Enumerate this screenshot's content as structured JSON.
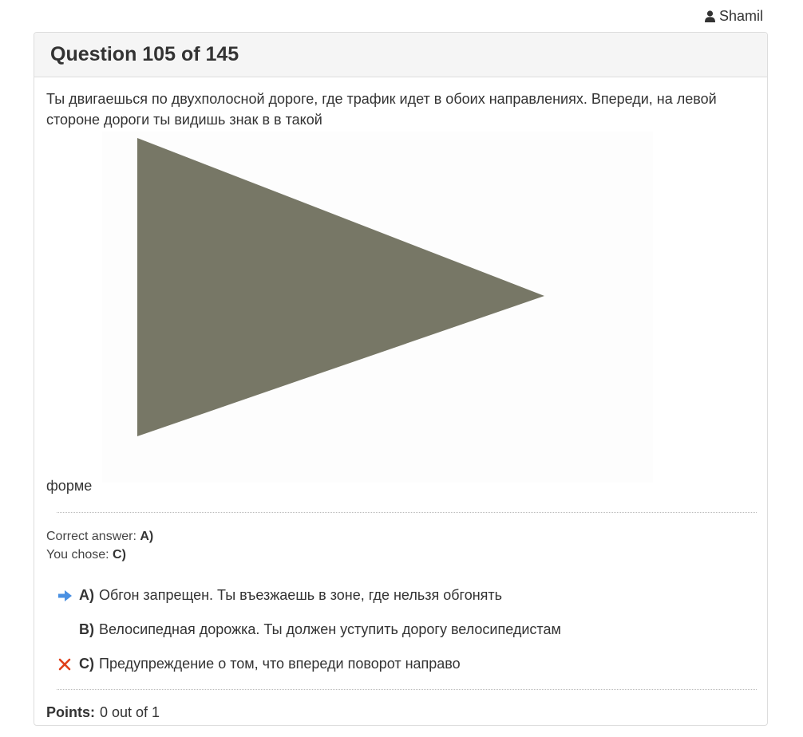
{
  "user": {
    "name": "Shamil",
    "icon": "user-icon"
  },
  "question": {
    "title": "Question 105 of 145",
    "text_before": "Ты двигаешься по двухполосной дороге, где трафик идет в обоих направлениях. Впереди, на левой стороне дороги ты видишь знак в в такой",
    "text_after": "форме",
    "sign_color": "#777766"
  },
  "result": {
    "correct_label": "Correct answer:",
    "correct_value": "A)",
    "chose_label": "You chose:",
    "chose_value": "C)"
  },
  "answers": [
    {
      "letter": "A)",
      "text": "Обгон запрещен. Ты въезжаешь в зоне, где нельзя обгонять",
      "marker": "arrow-right-icon"
    },
    {
      "letter": "B)",
      "text": "Велосипедная дорожка. Ты должен уступить дорогу велосипедистам",
      "marker": ""
    },
    {
      "letter": "C)",
      "text": "Предупреждение о том, что впереди поворот направо",
      "marker": "cross-icon"
    }
  ],
  "points": {
    "label": "Points:",
    "value": "0 out of 1"
  },
  "colors": {
    "arrow": "#4a90e2",
    "cross": "#e0401a",
    "panel_border": "#dddddd",
    "heading_bg": "#f5f5f5"
  }
}
